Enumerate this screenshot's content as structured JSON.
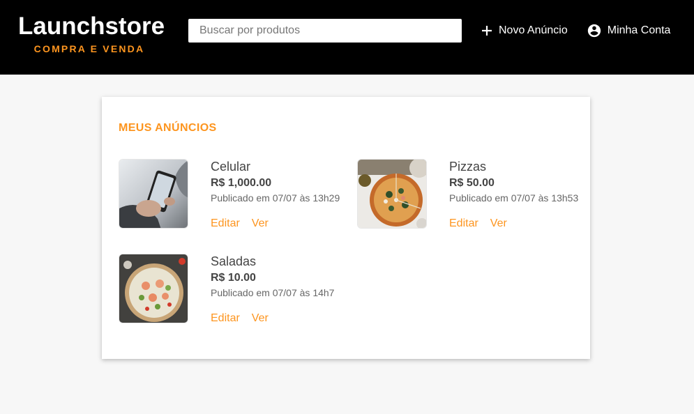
{
  "header": {
    "logo_title": "Launchstore",
    "logo_tagline": "COMPRA E VENDA",
    "search_placeholder": "Buscar por produtos",
    "new_ad_label": "Novo Anúncio",
    "account_label": "Minha Conta"
  },
  "section": {
    "title": "MEUS ANÚNCIOS"
  },
  "products": [
    {
      "name": "Celular",
      "price": "R$ 1,000.00",
      "published": "Publicado em 07/07 às 13h29",
      "edit_label": "Editar",
      "view_label": "Ver"
    },
    {
      "name": "Pizzas",
      "price": "R$ 50.00",
      "published": "Publicado em 07/07 às 13h53",
      "edit_label": "Editar",
      "view_label": "Ver"
    },
    {
      "name": "Saladas",
      "price": "R$ 10.00",
      "published": "Publicado em 07/07 às 14h7",
      "edit_label": "Editar",
      "view_label": "Ver"
    }
  ],
  "colors": {
    "accent": "#fd951f",
    "header_bg": "#000000",
    "page_bg": "#f7f7f7"
  }
}
